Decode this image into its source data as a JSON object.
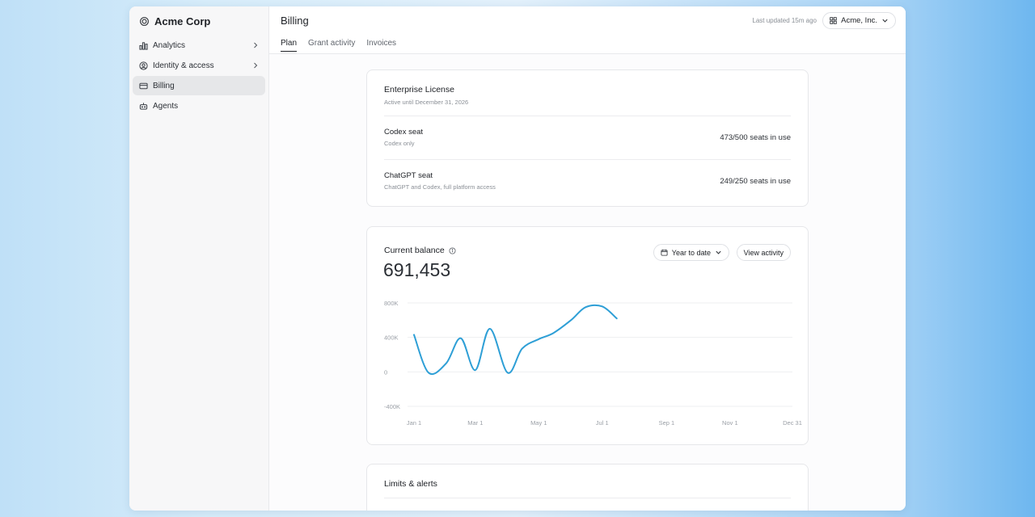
{
  "sidebar": {
    "brand": "Acme Corp",
    "brand_icon": "openai-logo-icon",
    "items": [
      {
        "label": "Analytics",
        "icon": "bar-chart-icon",
        "has_chevron": true,
        "active": false
      },
      {
        "label": "Identity & access",
        "icon": "user-circle-icon",
        "has_chevron": true,
        "active": false
      },
      {
        "label": "Billing",
        "icon": "credit-card-icon",
        "has_chevron": false,
        "active": true
      },
      {
        "label": "Agents",
        "icon": "robot-icon",
        "has_chevron": false,
        "active": false
      }
    ]
  },
  "header": {
    "title": "Billing",
    "tabs": [
      {
        "label": "Plan",
        "active": true
      },
      {
        "label": "Grant activity",
        "active": false
      },
      {
        "label": "Invoices",
        "active": false
      }
    ],
    "last_updated": "Last updated 15m ago",
    "org_selector": "Acme, Inc."
  },
  "license": {
    "title": "Enterprise License",
    "subtitle": "Active until December 31, 2026",
    "seats": [
      {
        "name": "Codex seat",
        "description": "Codex only",
        "usage": "473/500 seats in use"
      },
      {
        "name": "ChatGPT seat",
        "description": "ChatGPT and Codex, full platform access",
        "usage": "249/250 seats in use"
      }
    ]
  },
  "balance": {
    "label": "Current balance",
    "value": "691,453",
    "range_label": "Year to date",
    "activity_label": "View activity"
  },
  "limits": {
    "title": "Limits & alerts"
  },
  "colors": {
    "accent_line": "#2e9fd6"
  },
  "chart_data": {
    "type": "line",
    "y_ticks": [
      "800K",
      "400K",
      "0",
      "-400K"
    ],
    "ylim": [
      -400000,
      800000
    ],
    "x_ticks": [
      "Jan 1",
      "Mar 1",
      "May 1",
      "Jul 1",
      "Sep 1",
      "Nov 1",
      "Dec 31"
    ],
    "grid": true,
    "series": [
      {
        "x": [
          "Jan 1",
          "Jan 15",
          "Feb 1",
          "Feb 15",
          "Mar 1",
          "Mar 15",
          "Apr 1",
          "Apr 15",
          "May 1",
          "May 15",
          "Jun 1",
          "Jun 15",
          "Jul 1",
          "Jul 15"
        ],
        "values": [
          430000,
          -10000,
          100000,
          390000,
          20000,
          500000,
          -10000,
          270000,
          380000,
          450000,
          600000,
          750000,
          760000,
          620000
        ]
      }
    ]
  }
}
